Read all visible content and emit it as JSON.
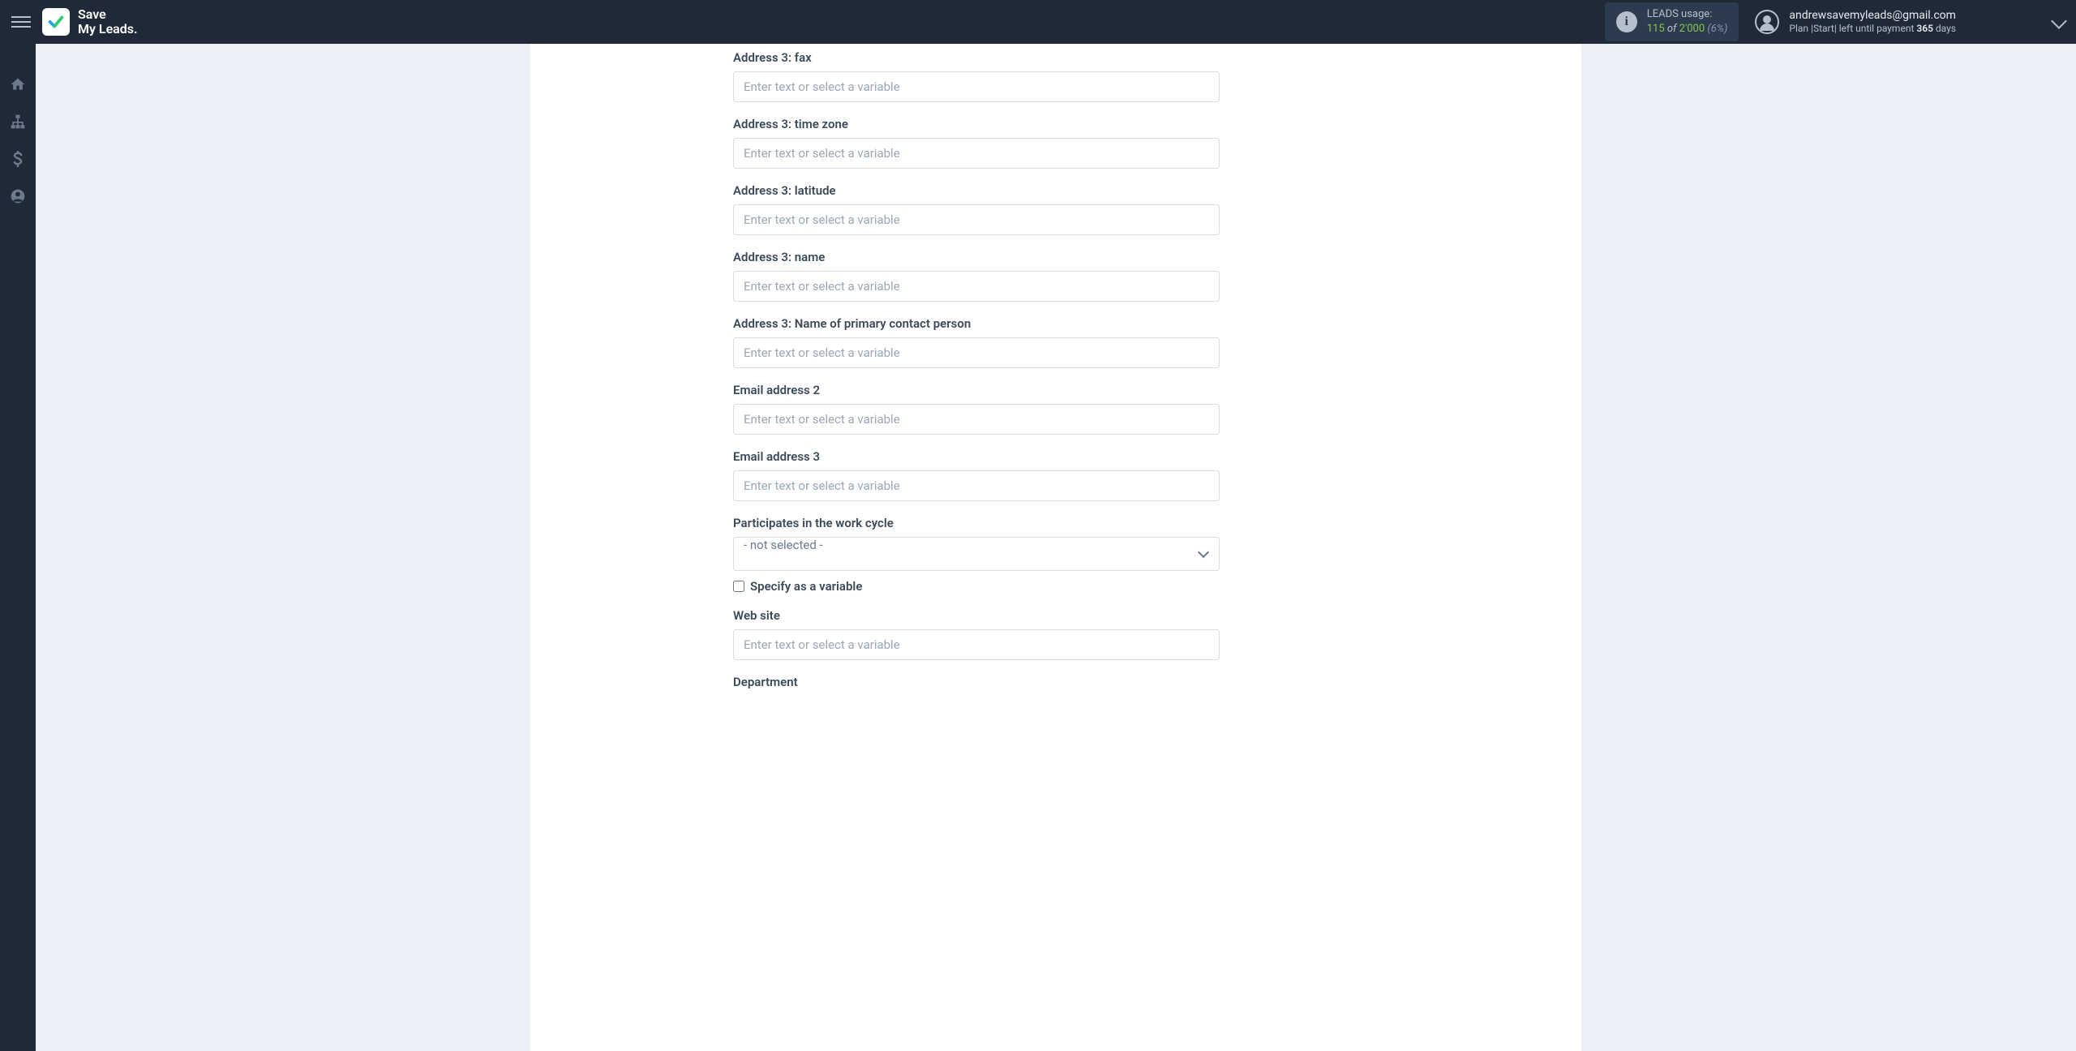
{
  "app": {
    "logo_line1": "Save",
    "logo_line2": "My Leads."
  },
  "header": {
    "leads_usage_label": "LEADS usage:",
    "leads_used": "115",
    "leads_of": "of",
    "leads_total": "2'000",
    "leads_pct": "(6%)",
    "user_email": "andrewsavemyleads@gmail.com",
    "plan_prefix": "Plan ",
    "plan_name": "|Start|",
    "plan_text": " left until payment ",
    "plan_days": "365",
    "plan_days_suffix": " days"
  },
  "form": {
    "placeholder": "Enter text or select a variable",
    "fields": [
      {
        "id": "addr3_fax",
        "label": "Address 3: fax"
      },
      {
        "id": "addr3_tz",
        "label": "Address 3: time zone"
      },
      {
        "id": "addr3_lat",
        "label": "Address 3: latitude"
      },
      {
        "id": "addr3_name",
        "label": "Address 3: name"
      },
      {
        "id": "addr3_primary_contact",
        "label": "Address 3: Name of primary contact person"
      },
      {
        "id": "email2",
        "label": "Email address 2"
      },
      {
        "id": "email3",
        "label": "Email address 3"
      }
    ],
    "select": {
      "label": "Participates in the work cycle",
      "value": "- not selected -",
      "checkbox_label": "Specify as a variable"
    },
    "website": {
      "label": "Web site"
    },
    "department_partial": "Department"
  }
}
